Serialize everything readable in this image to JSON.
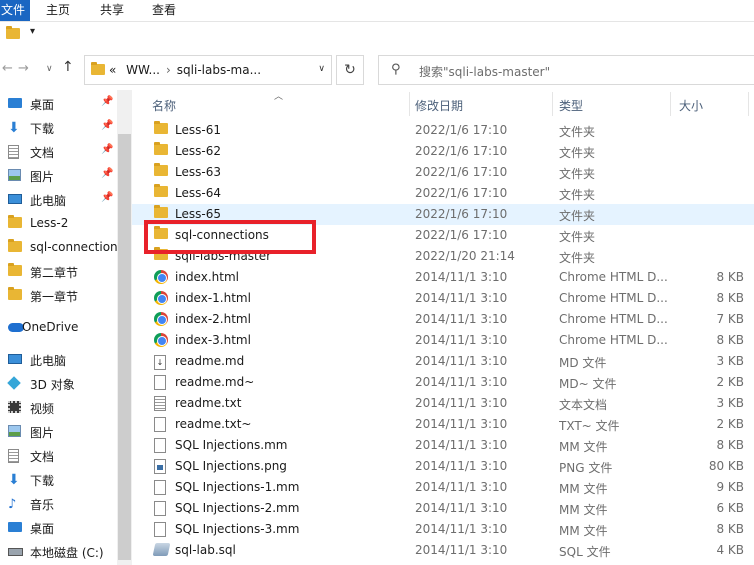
{
  "ribbon": {
    "tabs": [
      "文件",
      "主页",
      "共享",
      "查看"
    ]
  },
  "qat": {
    "dropdown_glyph": "▾"
  },
  "address": {
    "prefix": "«",
    "segments": [
      "WW...",
      "sqli-labs-ma..."
    ],
    "separator": "›"
  },
  "search": {
    "placeholder": "搜索\"sqli-labs-master\""
  },
  "navpane": {
    "items": [
      {
        "label": "桌面",
        "icon": "desktop-icon",
        "pinned": true
      },
      {
        "label": "下载",
        "icon": "download-icon",
        "pinned": true
      },
      {
        "label": "文档",
        "icon": "documents-icon",
        "pinned": true
      },
      {
        "label": "图片",
        "icon": "pictures-icon",
        "pinned": true
      },
      {
        "label": "此电脑",
        "icon": "this-pc-icon",
        "pinned": true
      },
      {
        "label": "Less-2",
        "icon": "folder-icon",
        "pinned": false
      },
      {
        "label": "sql-connection",
        "icon": "folder-icon",
        "pinned": false
      },
      {
        "label": "第二章节",
        "icon": "folder-icon",
        "pinned": false
      },
      {
        "label": "第一章节",
        "icon": "folder-icon",
        "pinned": false
      },
      {
        "label": "OneDrive",
        "icon": "onedrive-icon",
        "pinned": false
      },
      {
        "label": "此电脑",
        "icon": "this-pc-icon",
        "pinned": false
      },
      {
        "label": "3D 对象",
        "icon": "3d-objects-icon",
        "pinned": false
      },
      {
        "label": "视频",
        "icon": "videos-icon",
        "pinned": false
      },
      {
        "label": "图片",
        "icon": "pictures-icon",
        "pinned": false
      },
      {
        "label": "文档",
        "icon": "documents-icon",
        "pinned": false
      },
      {
        "label": "下载",
        "icon": "download-icon",
        "pinned": false
      },
      {
        "label": "音乐",
        "icon": "music-icon",
        "pinned": false
      },
      {
        "label": "桌面",
        "icon": "desktop-icon",
        "pinned": false
      },
      {
        "label": "本地磁盘 (C:)",
        "icon": "local-disk-icon",
        "pinned": false
      }
    ]
  },
  "columns": {
    "name": "名称",
    "date": "修改日期",
    "type": "类型",
    "size": "大小"
  },
  "files": [
    {
      "name": "Less-61",
      "date": "2022/1/6 17:10",
      "type": "文件夹",
      "size": "",
      "icon": "folder"
    },
    {
      "name": "Less-62",
      "date": "2022/1/6 17:10",
      "type": "文件夹",
      "size": "",
      "icon": "folder"
    },
    {
      "name": "Less-63",
      "date": "2022/1/6 17:10",
      "type": "文件夹",
      "size": "",
      "icon": "folder"
    },
    {
      "name": "Less-64",
      "date": "2022/1/6 17:10",
      "type": "文件夹",
      "size": "",
      "icon": "folder"
    },
    {
      "name": "Less-65",
      "date": "2022/1/6 17:10",
      "type": "文件夹",
      "size": "",
      "icon": "folder"
    },
    {
      "name": "sql-connections",
      "date": "2022/1/6 17:10",
      "type": "文件夹",
      "size": "",
      "icon": "folder"
    },
    {
      "name": "sqli-labs-master",
      "date": "2022/1/20 21:14",
      "type": "文件夹",
      "size": "",
      "icon": "folder"
    },
    {
      "name": "index.html",
      "date": "2014/11/1 3:10",
      "type": "Chrome HTML D...",
      "size": "8 KB",
      "icon": "chrome"
    },
    {
      "name": "index-1.html",
      "date": "2014/11/1 3:10",
      "type": "Chrome HTML D...",
      "size": "8 KB",
      "icon": "chrome"
    },
    {
      "name": "index-2.html",
      "date": "2014/11/1 3:10",
      "type": "Chrome HTML D...",
      "size": "7 KB",
      "icon": "chrome"
    },
    {
      "name": "index-3.html",
      "date": "2014/11/1 3:10",
      "type": "Chrome HTML D...",
      "size": "8 KB",
      "icon": "chrome"
    },
    {
      "name": "readme.md",
      "date": "2014/11/1 3:10",
      "type": "MD 文件",
      "size": "3 KB",
      "icon": "md"
    },
    {
      "name": "readme.md~",
      "date": "2014/11/1 3:10",
      "type": "MD~ 文件",
      "size": "2 KB",
      "icon": "doc"
    },
    {
      "name": "readme.txt",
      "date": "2014/11/1 3:10",
      "type": "文本文档",
      "size": "3 KB",
      "icon": "txt"
    },
    {
      "name": "readme.txt~",
      "date": "2014/11/1 3:10",
      "type": "TXT~ 文件",
      "size": "2 KB",
      "icon": "doc"
    },
    {
      "name": "SQL Injections.mm",
      "date": "2014/11/1 3:10",
      "type": "MM 文件",
      "size": "8 KB",
      "icon": "doc"
    },
    {
      "name": "SQL Injections.png",
      "date": "2014/11/1 3:10",
      "type": "PNG 文件",
      "size": "80 KB",
      "icon": "png"
    },
    {
      "name": "SQL Injections-1.mm",
      "date": "2014/11/1 3:10",
      "type": "MM 文件",
      "size": "9 KB",
      "icon": "doc"
    },
    {
      "name": "SQL Injections-2.mm",
      "date": "2014/11/1 3:10",
      "type": "MM 文件",
      "size": "6 KB",
      "icon": "doc"
    },
    {
      "name": "SQL Injections-3.mm",
      "date": "2014/11/1 3:10",
      "type": "MM 文件",
      "size": "8 KB",
      "icon": "doc"
    },
    {
      "name": "sql-lab.sql",
      "date": "2014/11/1 3:10",
      "type": "SQL 文件",
      "size": "4 KB",
      "icon": "sql"
    }
  ],
  "selected_file": "Less-65",
  "highlighted_file": "sql-connections",
  "colors": {
    "file_tab": "#1a66c2",
    "selection": "#e5f3ff",
    "annotation_box": "#e8212a",
    "folder": "#e9b634"
  }
}
